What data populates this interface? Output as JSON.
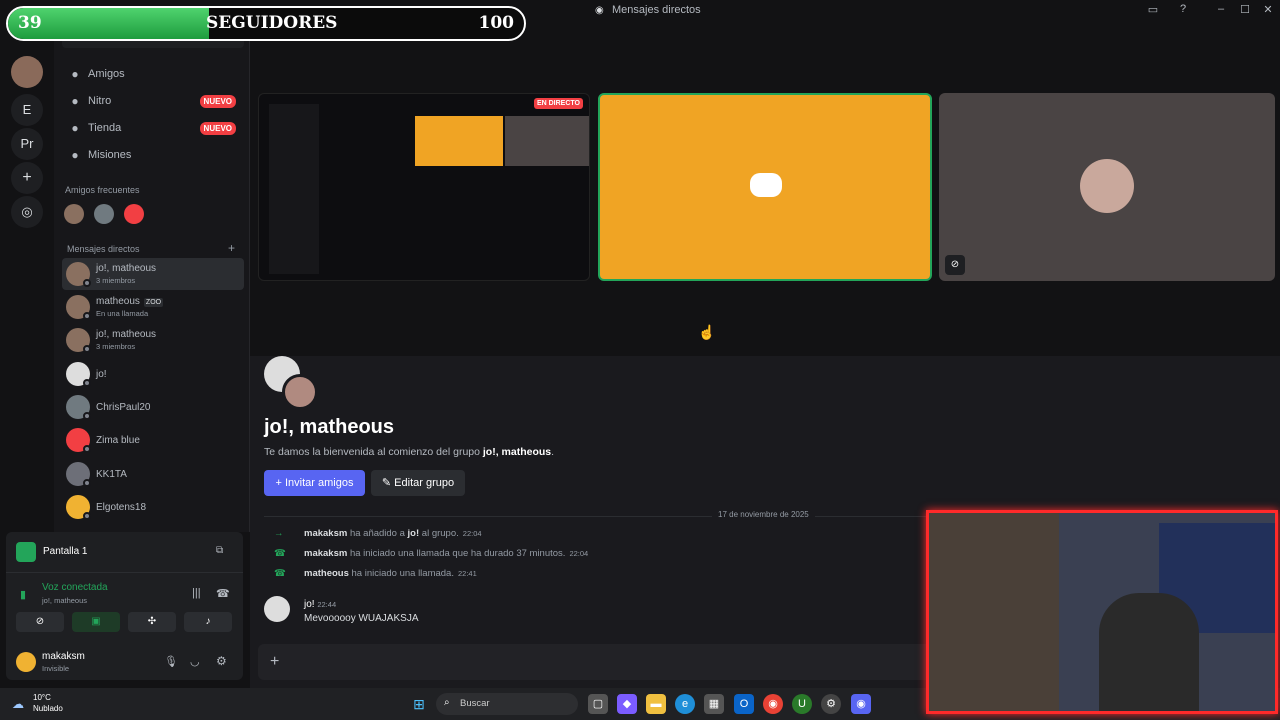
{
  "window": {
    "title": "Mensajes directos"
  },
  "overlay": {
    "count": "39",
    "label": "SEGUIDORES",
    "goal": "100",
    "progress_fraction": 0.39
  },
  "rail": {
    "server1": "E",
    "server2": "Pr"
  },
  "sidebar": {
    "nav": [
      {
        "label": "Amigos",
        "icon": "friends-icon",
        "badge": ""
      },
      {
        "label": "Nitro",
        "icon": "nitro-icon",
        "badge": "NUEVO"
      },
      {
        "label": "Tienda",
        "icon": "shop-icon",
        "badge": "NUEVO"
      },
      {
        "label": "Misiones",
        "icon": "quests-icon",
        "badge": ""
      }
    ],
    "frequent_title": "Amigos frecuentes",
    "dm_title": "Mensajes directos",
    "dms": [
      {
        "name": "jo!, matheous",
        "sub": "3 miembros"
      },
      {
        "name": "matheous",
        "tag": "ZOO",
        "sub": "En una llamada"
      },
      {
        "name": "jo!, matheous",
        "sub": "3 miembros"
      },
      {
        "name": "jo!",
        "sub": ""
      },
      {
        "name": "ChrisPaul20",
        "sub": ""
      },
      {
        "name": "Zima blue",
        "sub": ""
      },
      {
        "name": "KK1TA",
        "sub": ""
      },
      {
        "name": "Elgotens18",
        "sub": ""
      }
    ]
  },
  "voice": {
    "screen_label": "Pantalla 1",
    "status": "Voz conectada",
    "channel": "jo!, matheous",
    "user": "makaksm",
    "user_status": "Invisible"
  },
  "stream": {
    "live_badge": "EN DIRECTO"
  },
  "group": {
    "title": "jo!, matheous",
    "welcome_prefix": "Te damos la bienvenida al comienzo del grupo ",
    "welcome_name": "jo!, matheous",
    "welcome_suffix": ".",
    "invite_label": "Invitar amigos",
    "edit_label": "Editar grupo"
  },
  "chat": {
    "date_divider": "17 de noviembre de 2025",
    "events": [
      {
        "user": "makaksm",
        "text1": " ha añadido a ",
        "target": "jo!",
        "text2": " al grupo.",
        "time": "22:04"
      },
      {
        "user": "makaksm",
        "text1": " ha iniciado una llamada que ha durado 37 minutos.",
        "target": "",
        "text2": "",
        "time": "22:04"
      },
      {
        "user": "matheous",
        "text1": " ha iniciado una llamada.",
        "target": "",
        "text2": "",
        "time": "22:41"
      }
    ],
    "message": {
      "author": "jo!",
      "time": "22:44",
      "text": "Mevoooooy WUAJAKSJA"
    }
  },
  "taskbar": {
    "temp": "10°C",
    "weather": "Nublado",
    "search": "Buscar"
  },
  "colors": {
    "accent": "#5865f2",
    "green": "#23a55a",
    "red": "#f23f43",
    "tile_orange": "#f0a424"
  }
}
